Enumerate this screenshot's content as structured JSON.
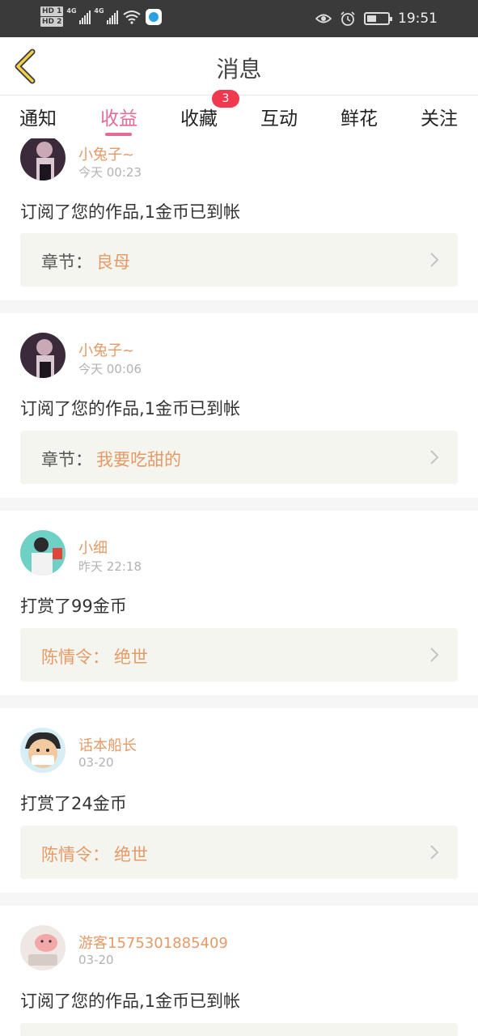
{
  "status_bar": {
    "hd1": "HD 1",
    "hd2": "HD 2",
    "net1": "4G",
    "net2": "4G",
    "time": "19:51",
    "icons": [
      "wifi-icon",
      "app-icon",
      "eye-icon",
      "alarm-icon",
      "battery-icon"
    ]
  },
  "header": {
    "title": "消息",
    "back_icon": "back-icon"
  },
  "tabs": [
    {
      "label": "通知"
    },
    {
      "label": "收益"
    },
    {
      "label": "收藏",
      "badge": "3"
    },
    {
      "label": "互动"
    },
    {
      "label": "鲜花"
    },
    {
      "label": "关注"
    }
  ],
  "active_tab": "收益",
  "accent_color": "#e46b95",
  "name_color": "#e59a67",
  "messages": [
    {
      "user": "小兔子~",
      "time": "今天 00:23",
      "text": "订阅了您的作品,1金币已到帐",
      "link_label": "章节：",
      "link_value": "良母"
    },
    {
      "user": "小兔子~",
      "time": "今天 00:06",
      "text": "订阅了您的作品,1金币已到帐",
      "link_label": "章节：",
      "link_value": "我要吃甜的"
    },
    {
      "user": "小细",
      "time": "昨天 22:18",
      "text": "打赏了99金币",
      "link_label": "陈情令：",
      "link_value": "绝世"
    },
    {
      "user": "话本船长",
      "time": "03-20",
      "text": "打赏了24金币",
      "link_label": "陈情令：",
      "link_value": "绝世"
    },
    {
      "user": "游客1575301885409",
      "time": "03-20",
      "text": "订阅了您的作品,1金币已到帐",
      "link_label": "",
      "link_value": ""
    }
  ]
}
